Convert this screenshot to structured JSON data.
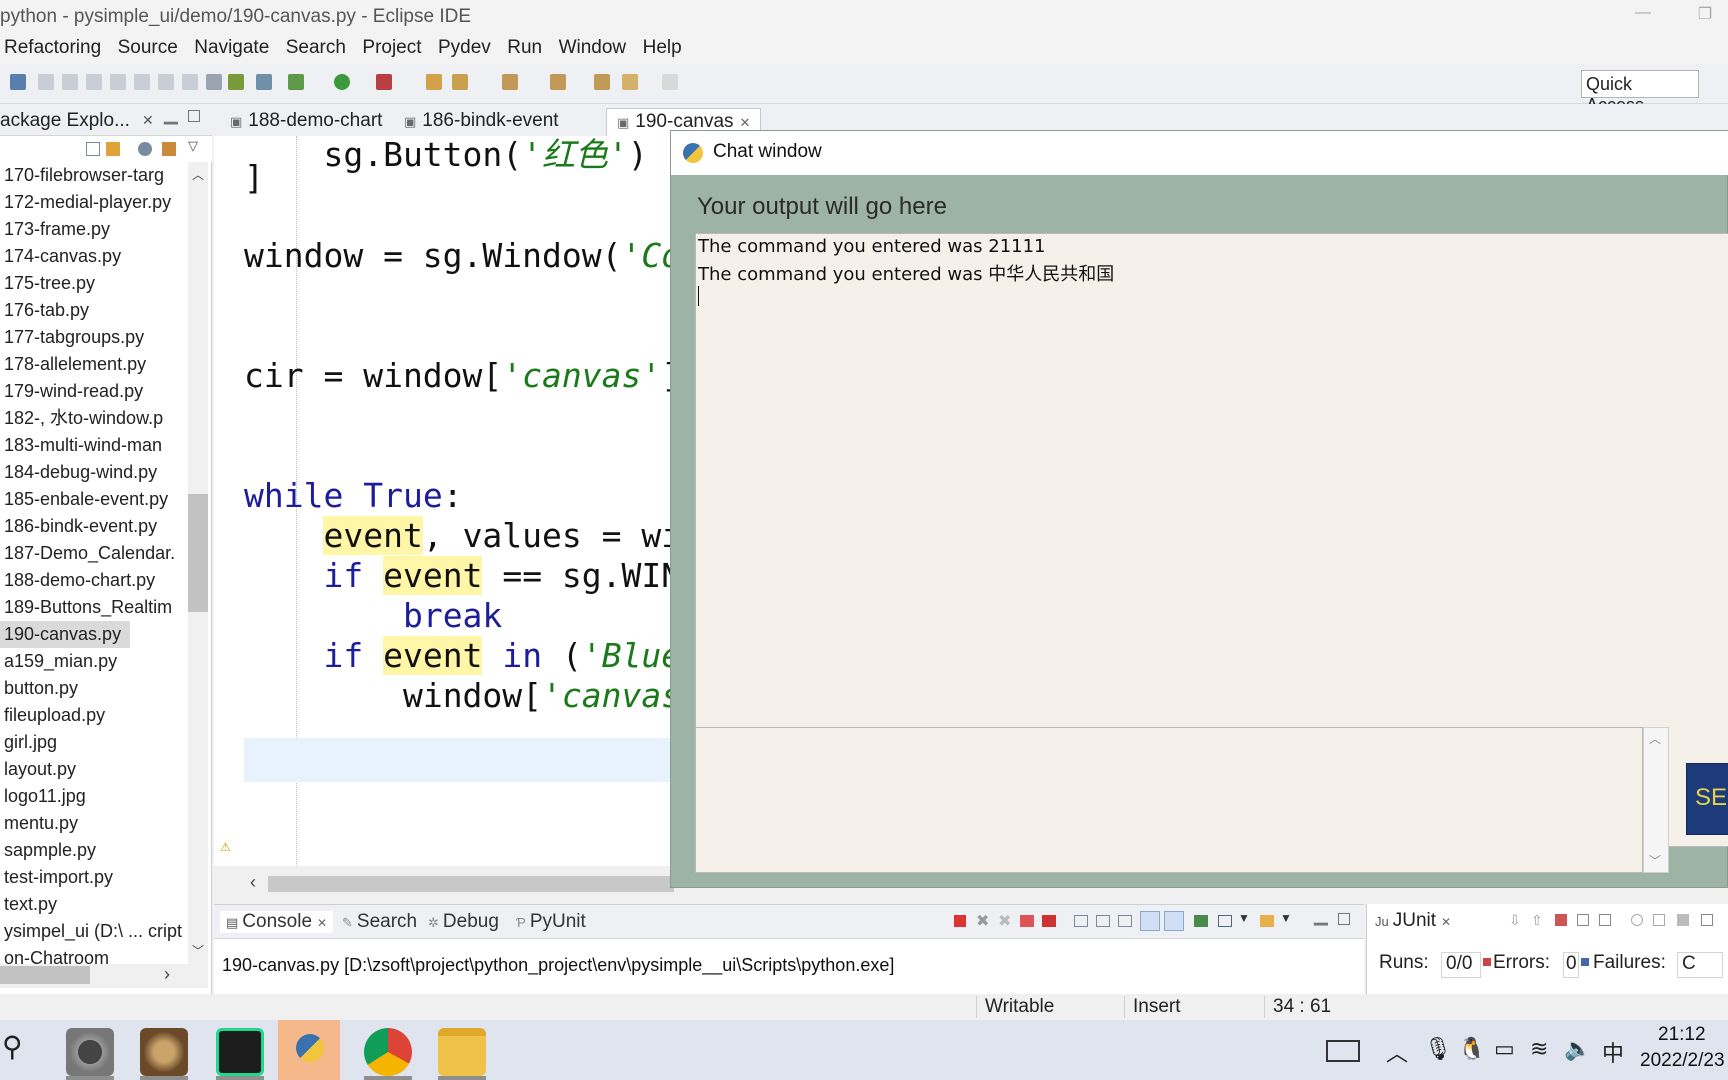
{
  "window": {
    "title": "python - pysimple_ui/demo/190-canvas.py - Eclipse IDE",
    "minimize": "—",
    "restore": "❐"
  },
  "menu": [
    "Refactoring",
    "Source",
    "Navigate",
    "Search",
    "Project",
    "Pydev",
    "Run",
    "Window",
    "Help"
  ],
  "toolbar": {
    "quick_access": "Quick Access"
  },
  "package_explorer": {
    "title": "ackage Explo...",
    "close": "✕",
    "items": [
      "170-filebrowser-targ",
      "172-medial-player.py",
      "173-frame.py",
      "174-canvas.py",
      "175-tree.py",
      "176-tab.py",
      "177-tabgroups.py",
      "178-allelement.py",
      "179-wind-read.py",
      "182-, 水to-window.p",
      "183-multi-wind-man",
      "184-debug-wind.py",
      "185-enbale-event.py",
      "186-bindk-event.py",
      "187-Demo_Calendar.",
      "188-demo-chart.py",
      "189-Buttons_Realtim",
      "190-canvas.py",
      "a159_mian.py",
      "button.py",
      "fileupload.py",
      "girl.jpg",
      "layout.py",
      "logo11.jpg",
      "mentu.py",
      "sapmple.py",
      "test-import.py",
      "text.py",
      "ysimpel_ui  (D:\\ ... cript",
      "on-Chatroom"
    ],
    "selected_index": 17
  },
  "editor_tabs": [
    {
      "label": "188-demo-chart",
      "close": ""
    },
    {
      "label": "186-bindk-event",
      "close": ""
    },
    {
      "label": "190-canvas",
      "close": "✕"
    }
  ],
  "code": {
    "l1_a": "    sg.Button(",
    "l1_b": "'红色'",
    "l1_c": ")",
    "l2": "]",
    "l3_a": "window = sg.Window(",
    "l3_b": "'Co",
    "l4_a": "cir = window[",
    "l4_b": "'canvas'",
    "l4_c": "]",
    "l5_a": "while",
    "l5_b": " ",
    "l5_c": "True",
    "l5_d": ":",
    "l6_a": "event",
    "l6_b": ", values = wi",
    "l7_a": "if",
    "l7_b": " ",
    "l7_c": "event",
    "l7_d": " == sg.WIN",
    "l8": "break",
    "l9_a": "if",
    "l9_b": " ",
    "l9_c": "event",
    "l9_d": " ",
    "l9_e": "in",
    "l9_f": " (",
    "l9_g": "'Blue",
    "l10_a": "window[",
    "l10_b": "'canvas"
  },
  "chat": {
    "title": "Chat window",
    "output_label": "Your output will go here",
    "lines": [
      "The command you entered was 21111",
      "The command you entered was 中华人民共和国"
    ],
    "send_label": "SE"
  },
  "bottom_tabs": [
    {
      "label": "Console",
      "close": "✕"
    },
    {
      "label": "Search"
    },
    {
      "label": "Debug"
    },
    {
      "label": "PyUnit"
    }
  ],
  "console_text": "190-canvas.py [D:\\zsoft\\project\\python_project\\env\\pysimple__ui\\Scripts\\python.exe]",
  "junit": {
    "tab": "JUnit",
    "close": "✕",
    "runs_label": "Runs:",
    "runs_value": "0/0",
    "errors_label": "Errors:",
    "errors_value": "0",
    "failures_label": "Failures:",
    "failures_value": "C"
  },
  "status": {
    "writable": "Writable",
    "insert": "Insert",
    "position": "34 : 61"
  },
  "taskbar": {
    "time": "21:12",
    "date": "2022/2/23",
    "ime": "中"
  },
  "colors": {
    "chat_bg": "#9db3a6",
    "send_bg": "#1d3a7a",
    "send_fg": "#e4d24b",
    "highlight": "#fff6a8"
  }
}
